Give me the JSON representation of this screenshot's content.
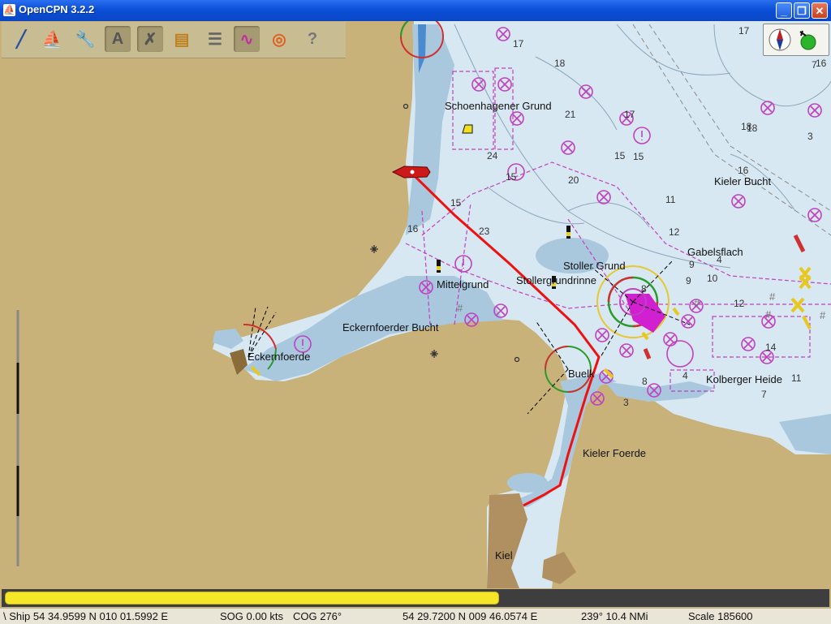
{
  "window": {
    "title": "OpenCPN 3.2.2",
    "min_label": "_",
    "max_label": "❐",
    "close_label": "✕"
  },
  "toolbar": {
    "tools": [
      {
        "name": "route-tool",
        "icon": "route-icon",
        "active": false
      },
      {
        "name": "ship-tool",
        "icon": "ship-icon",
        "active": false
      },
      {
        "name": "settings-tool",
        "icon": "wrench-icon",
        "active": false
      },
      {
        "name": "text-tool",
        "icon": "text-icon",
        "active": true
      },
      {
        "name": "clear-tool",
        "icon": "x-icon",
        "active": true
      },
      {
        "name": "chart-tool",
        "icon": "chart-icon",
        "active": false
      },
      {
        "name": "route-manager-tool",
        "icon": "list-icon",
        "active": false
      },
      {
        "name": "track-tool",
        "icon": "track-icon",
        "active": true
      },
      {
        "name": "mob-tool",
        "icon": "lifebuoy-icon",
        "active": false
      },
      {
        "name": "help-tool",
        "icon": "help-icon",
        "active": false
      }
    ]
  },
  "map": {
    "place_labels": [
      {
        "id": "schoenhagener",
        "text": "Schoenhagener Grund"
      },
      {
        "id": "kieler-bucht",
        "text": "Kieler Bucht"
      },
      {
        "id": "gabelsflach",
        "text": "Gabelsflach"
      },
      {
        "id": "stoller-grund",
        "text": "Stoller Grund"
      },
      {
        "id": "stollergrundrinne",
        "text": "Stollergrundrinne"
      },
      {
        "id": "mittelgrund",
        "text": "Mittelgrund"
      },
      {
        "id": "eckernfoerder-bucht",
        "text": "Eckernfoerder Bucht"
      },
      {
        "id": "eckernfoerde",
        "text": "Eckernfoerde"
      },
      {
        "id": "buelk",
        "text": "Buelk"
      },
      {
        "id": "kolberger-heide",
        "text": "Kolberger Heide"
      },
      {
        "id": "kieler-foerde",
        "text": "Kieler Foerde"
      },
      {
        "id": "kiel",
        "text": "Kiel"
      }
    ],
    "depths": [
      "17",
      "18",
      "17",
      "16",
      "21",
      "18",
      "24",
      "20",
      "15",
      "15",
      "11",
      "12",
      "15",
      "9",
      "23",
      "16",
      "9",
      "8",
      "10",
      "12",
      "14",
      "11",
      "7",
      "8",
      "4",
      "3",
      "18",
      "7",
      "3",
      "4",
      "17",
      "16",
      "18",
      "15"
    ]
  },
  "colors": {
    "land": "#c8b27a",
    "shallow": "#a9c8de",
    "water": "#d8e8f2",
    "route": "#ee1111",
    "magenta": "#c040c0"
  },
  "progress": {
    "fraction": 0.6
  },
  "status": {
    "ship": "\\ Ship 54 34.9599 N   010 01.5992 E",
    "sog": "SOG 0.00 kts",
    "cog": "COG 276°",
    "cursor": "54 29.7200 N   009 46.0574 E",
    "bearing": "239°  10.4 NMi",
    "scale": "Scale 185600"
  }
}
